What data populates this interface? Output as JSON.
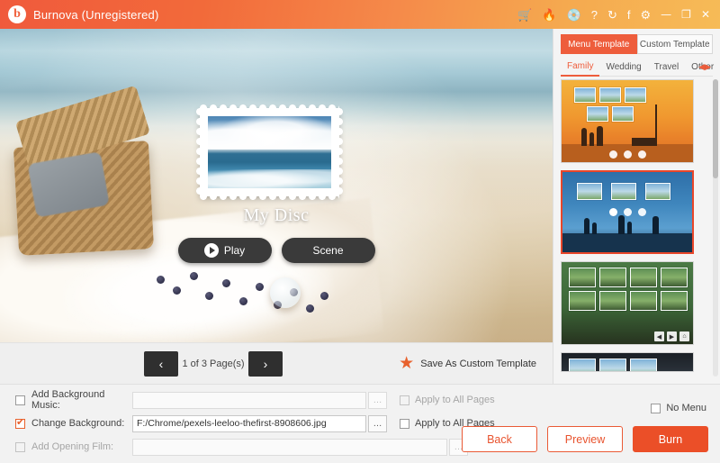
{
  "window": {
    "title": "Burnova (Unregistered)",
    "logo_glyph": "b",
    "icons": [
      {
        "name": "cart-icon",
        "glyph": "🛒"
      },
      {
        "name": "flame-icon",
        "glyph": "🔥"
      },
      {
        "name": "disc-icon",
        "glyph": "💿"
      },
      {
        "name": "help-icon",
        "glyph": "?"
      },
      {
        "name": "refresh-icon",
        "glyph": "↻"
      },
      {
        "name": "facebook-icon",
        "glyph": "f"
      },
      {
        "name": "settings-icon",
        "glyph": "⚙"
      },
      {
        "name": "minimize-icon",
        "glyph": "—"
      },
      {
        "name": "maximize-icon",
        "glyph": "❐"
      },
      {
        "name": "close-icon",
        "glyph": "✕"
      }
    ]
  },
  "preview": {
    "disc_title": "My Disc",
    "play_label": "Play",
    "scene_label": "Scene"
  },
  "pager": {
    "prev_glyph": "‹",
    "next_glyph": "›",
    "page_text": "1 of 3 Page(s)",
    "save_template_label": "Save As Custom Template",
    "star_glyph": "★"
  },
  "right_panel": {
    "tabs": [
      {
        "label": "Menu Template",
        "active": true
      },
      {
        "label": "Custom Template",
        "active": false
      }
    ],
    "subtabs": [
      {
        "label": "Family",
        "active": true
      },
      {
        "label": "Wedding",
        "active": false
      },
      {
        "label": "Travel",
        "active": false
      },
      {
        "label": "Other",
        "active": false
      }
    ],
    "subtab_arrow": "◀▶",
    "templates": [
      {
        "name": "template-family-sunset",
        "selected": false
      },
      {
        "name": "template-family-blue",
        "selected": true
      },
      {
        "name": "template-family-green",
        "selected": false
      },
      {
        "name": "template-family-dark",
        "selected": false
      }
    ]
  },
  "bottom": {
    "rows": [
      {
        "name": "add-background-music",
        "label": "Add Background Music:",
        "checked": false,
        "enabled": false,
        "value": "",
        "placeholder": "",
        "browse_glyph": "…",
        "apply_label": "Apply to All Pages",
        "apply_checked": false,
        "apply_enabled": false
      },
      {
        "name": "change-background",
        "label": "Change Background:",
        "checked": true,
        "enabled": true,
        "value": "F:/Chrome/pexels-leeloo-thefirst-8908606.jpg",
        "placeholder": "",
        "browse_glyph": "…",
        "apply_label": "Apply to All Pages",
        "apply_checked": false,
        "apply_enabled": true
      },
      {
        "name": "add-opening-film",
        "label": "Add Opening Film:",
        "checked": false,
        "enabled": false,
        "value": "",
        "placeholder": "",
        "browse_glyph": "…",
        "apply_label": "",
        "apply_checked": false,
        "apply_enabled": false
      }
    ],
    "no_menu_label": "No Menu",
    "no_menu_checked": false,
    "buttons": [
      {
        "name": "back-button",
        "label": "Back",
        "primary": false
      },
      {
        "name": "preview-button",
        "label": "Preview",
        "primary": false
      },
      {
        "name": "burn-button",
        "label": "Burn",
        "primary": true
      }
    ]
  },
  "colors": {
    "accent": "#ee5d3c",
    "burn": "#eb4f28",
    "title_gradient_start": "#f05a3c",
    "title_gradient_end": "#f6bb57",
    "selected_border": "#e8462a"
  }
}
